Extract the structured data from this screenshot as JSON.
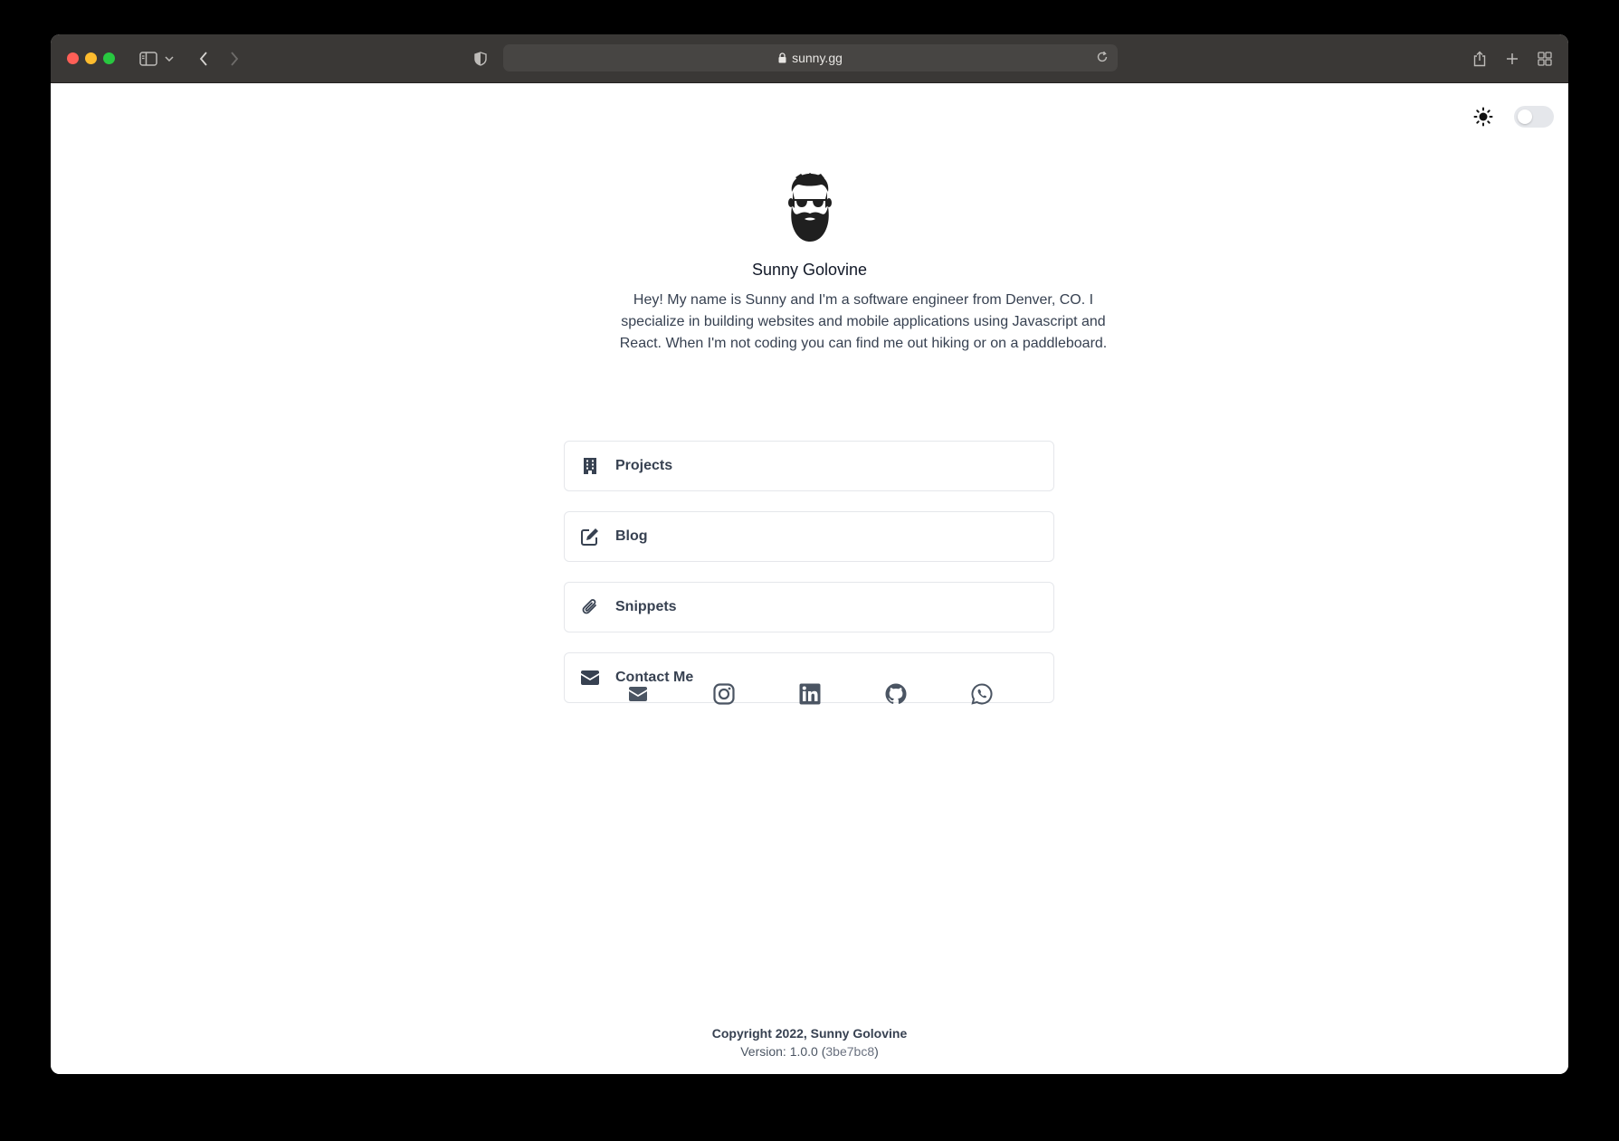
{
  "browser": {
    "url": "sunny.gg",
    "traffic_colors": {
      "close": "#ff5f57",
      "minimize": "#febc2e",
      "maximize": "#28c840"
    }
  },
  "theme": {
    "icon": "sun-icon",
    "dark_mode_enabled": false
  },
  "profile": {
    "avatar_icon": "bearded-man-avatar-icon",
    "name": "Sunny Golovine",
    "bio": "Hey! My name is Sunny and I'm a software engineer from Denver, CO. I specialize in building websites and mobile applications using Javascript and React. When I'm not coding you can find me out hiking or on a paddleboard."
  },
  "links": [
    {
      "label": "Projects",
      "icon": "building-icon"
    },
    {
      "label": "Blog",
      "icon": "edit-icon"
    },
    {
      "label": "Snippets",
      "icon": "paperclip-icon"
    },
    {
      "label": "Contact Me",
      "icon": "envelope-icon"
    }
  ],
  "social": [
    {
      "name": "email",
      "icon": "envelope-icon"
    },
    {
      "name": "instagram",
      "icon": "instagram-icon"
    },
    {
      "name": "linkedin",
      "icon": "linkedin-icon"
    },
    {
      "name": "github",
      "icon": "github-icon"
    },
    {
      "name": "whatsapp",
      "icon": "whatsapp-icon"
    }
  ],
  "footer": {
    "copyright": "Copyright 2022, Sunny Golovine",
    "version_prefix": "Version: 1.0.0 (",
    "version_hash": "3be7bc8",
    "version_suffix": ")"
  },
  "colors": {
    "text_primary": "#111827",
    "text_secondary": "#374151",
    "icon_gray": "#4b5563",
    "border": "#e5e7eb"
  }
}
